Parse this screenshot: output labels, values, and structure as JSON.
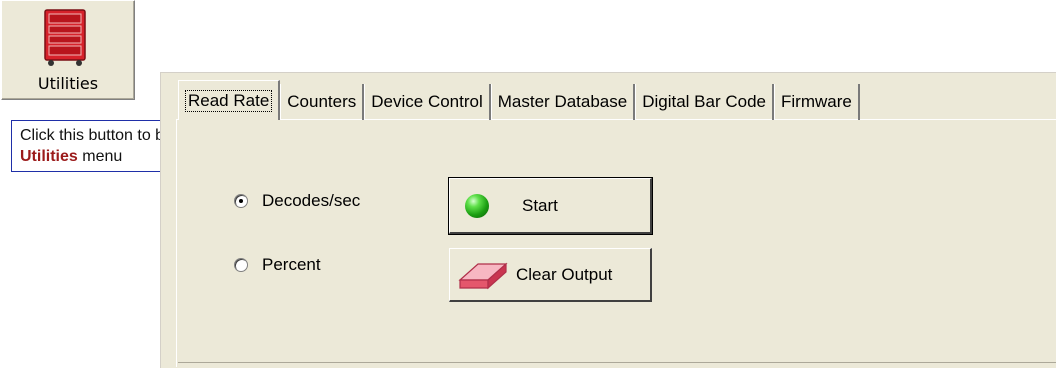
{
  "toolbar": {
    "utilities_label": "Utilities",
    "utilities_icon": "toolbox-icon",
    "icon_color": "#d6212a"
  },
  "callout": {
    "prefix": "Click this button to bring up the ",
    "highlight": "Utilities",
    "suffix": " menu",
    "highlight_color": "#9b1a1a"
  },
  "tabs": [
    {
      "label": "Read Rate",
      "active": true
    },
    {
      "label": "Counters",
      "active": false
    },
    {
      "label": "Device Control",
      "active": false
    },
    {
      "label": "Master Database",
      "active": false
    },
    {
      "label": "Digital Bar Code",
      "active": false
    },
    {
      "label": "Firmware",
      "active": false
    }
  ],
  "read_rate": {
    "mode_options": [
      {
        "label": "Decodes/sec",
        "selected": true
      },
      {
        "label": "Percent",
        "selected": false
      }
    ],
    "start_label": "Start",
    "start_icon": "green-light-icon",
    "clear_label": "Clear Output",
    "clear_icon": "eraser-icon"
  }
}
